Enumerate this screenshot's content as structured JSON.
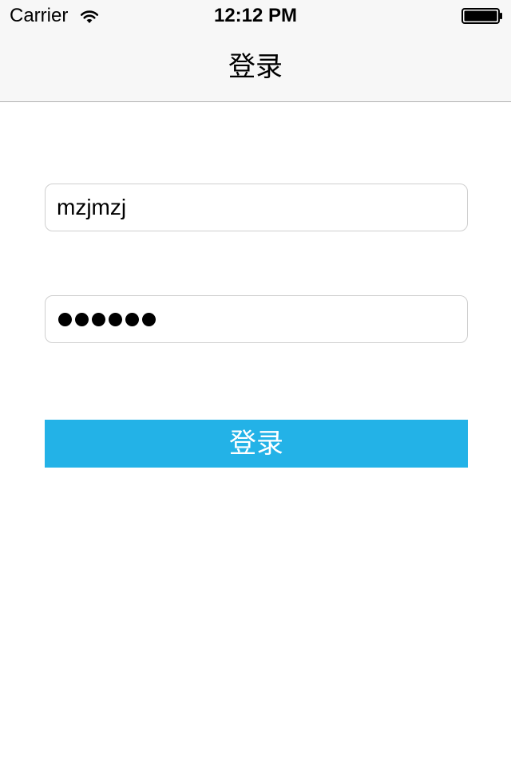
{
  "status_bar": {
    "carrier": "Carrier",
    "time": "12:12 PM",
    "wifi_icon": "wifi-icon",
    "battery_icon": "battery-full-icon"
  },
  "nav": {
    "title": "登录"
  },
  "form": {
    "username_value": "mzjmzj",
    "password_masked": "●●●●●●",
    "password_length": 6,
    "login_button_label": "登录"
  },
  "colors": {
    "button_background": "#23b2e7",
    "button_text": "#ffffff",
    "navbar_background": "#f7f7f7",
    "field_border": "#cfcfcf"
  }
}
